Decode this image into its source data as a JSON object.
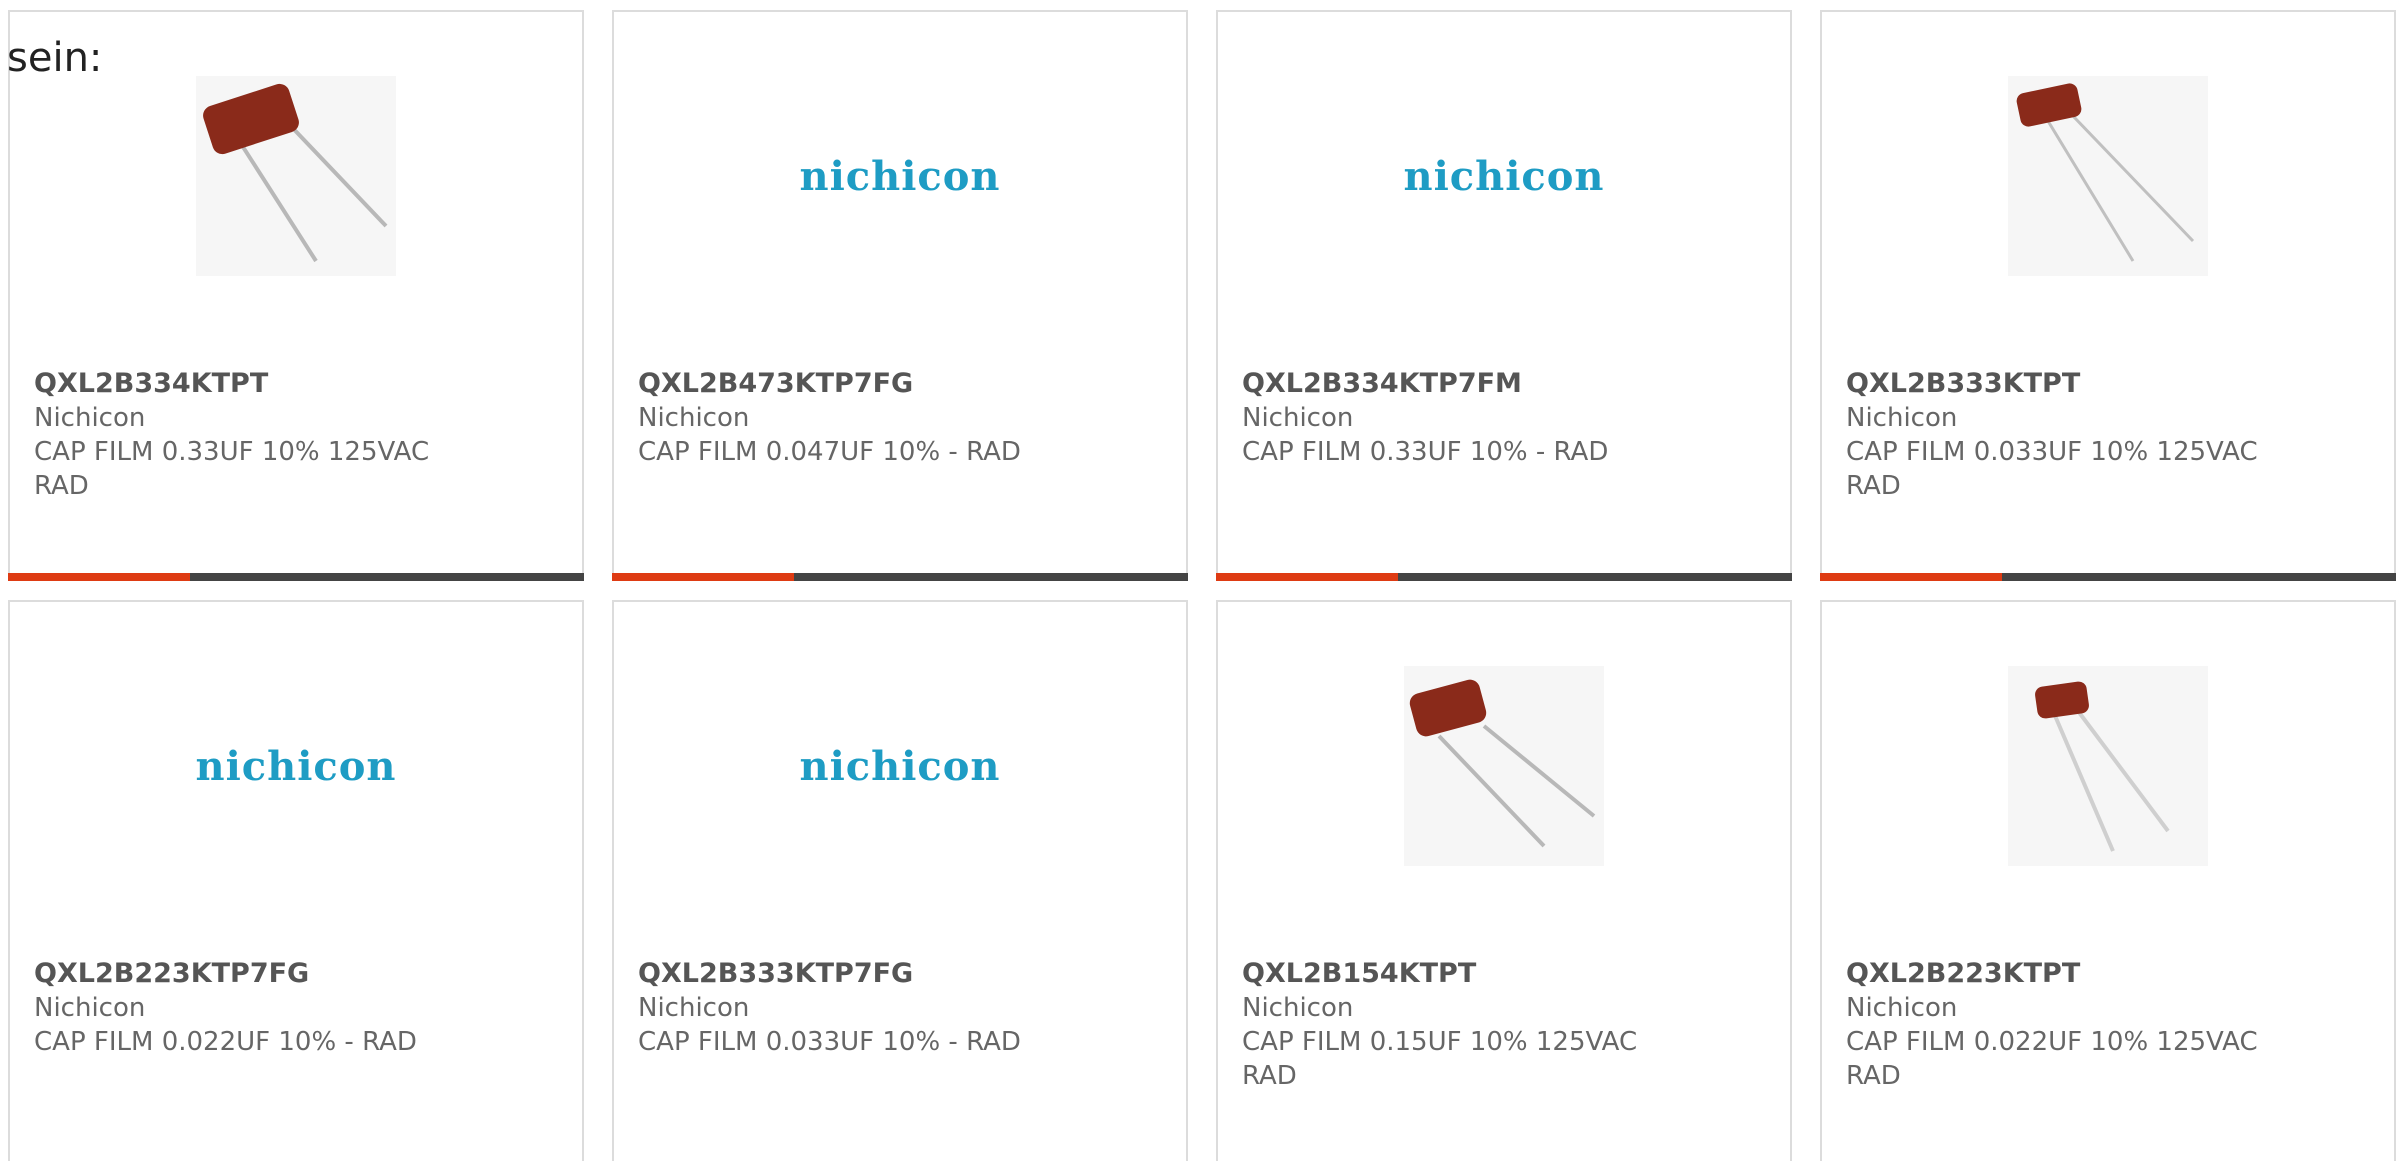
{
  "intro_text": "sein:",
  "accent_color": "#de3b13",
  "bar_color": "#444444",
  "logo_color": "#1e9cc4",
  "products": [
    {
      "part": "QXL2B334KTPT",
      "maker": "Nichicon",
      "desc1": "CAP FILM 0.33UF 10% 125VAC",
      "desc2": "RAD",
      "image": "capacitor-photo"
    },
    {
      "part": "QXL2B473KTP7FG",
      "maker": "Nichicon",
      "desc1": "CAP FILM 0.047UF 10% - RAD",
      "desc2": "",
      "image": "nichicon-logo",
      "logo_text": "nichicon"
    },
    {
      "part": "QXL2B334KTP7FM",
      "maker": "Nichicon",
      "desc1": "CAP FILM 0.33UF 10% - RAD",
      "desc2": "",
      "image": "nichicon-logo",
      "logo_text": "nichicon"
    },
    {
      "part": "QXL2B333KTPT",
      "maker": "Nichicon",
      "desc1": "CAP FILM 0.033UF 10% 125VAC",
      "desc2": "RAD",
      "image": "capacitor-photo"
    },
    {
      "part": "QXL2B223KTP7FG",
      "maker": "Nichicon",
      "desc1": "CAP FILM 0.022UF 10% - RAD",
      "desc2": "",
      "image": "nichicon-logo",
      "logo_text": "nichicon"
    },
    {
      "part": "QXL2B333KTP7FG",
      "maker": "Nichicon",
      "desc1": "CAP FILM 0.033UF 10% - RAD",
      "desc2": "",
      "image": "nichicon-logo",
      "logo_text": "nichicon"
    },
    {
      "part": "QXL2B154KTPT",
      "maker": "Nichicon",
      "desc1": "CAP FILM 0.15UF 10% 125VAC",
      "desc2": "RAD",
      "image": "capacitor-photo"
    },
    {
      "part": "QXL2B223KTPT",
      "maker": "Nichicon",
      "desc1": "CAP FILM 0.022UF 10% 125VAC",
      "desc2": "RAD",
      "image": "capacitor-photo"
    }
  ]
}
